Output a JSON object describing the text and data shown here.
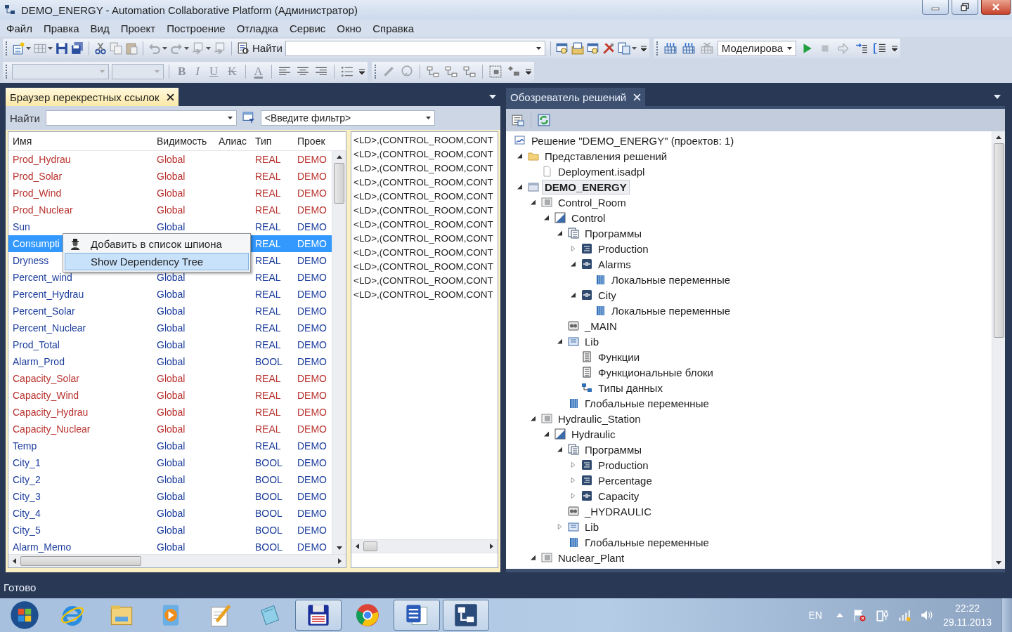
{
  "window": {
    "title": "DEMO_ENERGY - Automation Collaborative Platform (Администратор)"
  },
  "menu": [
    "Файл",
    "Правка",
    "Вид",
    "Проект",
    "Построение",
    "Отладка",
    "Сервис",
    "Окно",
    "Справка"
  ],
  "toolbar": {
    "find_label": "Найти",
    "mode": "Моделирова"
  },
  "format_buttons": [
    {
      "label": "B",
      "kind": "bold",
      "disabled": true
    },
    {
      "label": "I",
      "kind": "italic",
      "disabled": true
    },
    {
      "label": "U",
      "kind": "underline",
      "disabled": true
    },
    {
      "label": "K",
      "kind": "strike",
      "disabled": true
    },
    {
      "label": "A",
      "kind": "color",
      "disabled": true
    }
  ],
  "xref_panel": {
    "tab": {
      "title": "Браузер перекрестных ссылок",
      "selected": true
    },
    "find_label": "Найти",
    "filter": {
      "placeholder": "<Введите фильтр>"
    },
    "columns": [
      "Имя",
      "Видимость",
      "Алиас",
      "Тип",
      "Проек"
    ],
    "rows": [
      {
        "name": "Prod_Hydrau",
        "visibility": "Global",
        "type": "REAL",
        "project": "DEMO",
        "color": "#b8322e",
        "selected": false
      },
      {
        "name": "Prod_Solar",
        "visibility": "Global",
        "type": "REAL",
        "project": "DEMO",
        "color": "#b8322e",
        "selected": false
      },
      {
        "name": "Prod_Wind",
        "visibility": "Global",
        "type": "REAL",
        "project": "DEMO",
        "color": "#b8322e",
        "selected": false
      },
      {
        "name": "Prod_Nuclear",
        "visibility": "Global",
        "type": "REAL",
        "project": "DEMO",
        "color": "#b8322e",
        "selected": false
      },
      {
        "name": "Sun",
        "visibility": "Global",
        "type": "REAL",
        "project": "DEMO",
        "color": "#1c3d9c",
        "selected": false
      },
      {
        "name": "Consumpti",
        "type": "REAL",
        "project": "DEMO",
        "selected": true
      },
      {
        "name": "Dryness",
        "type": "REAL",
        "project": "DEMO",
        "color": "#1c3d9c",
        "selected": false
      },
      {
        "name": "Percent_wind",
        "visibility": "Global",
        "type": "REAL",
        "project": "DEMO",
        "color": "#1c3d9c",
        "selected": false
      },
      {
        "name": "Percent_Hydrau",
        "visibility": "Global",
        "type": "REAL",
        "project": "DEMO",
        "color": "#1c3d9c",
        "selected": false
      },
      {
        "name": "Percent_Solar",
        "visibility": "Global",
        "type": "REAL",
        "project": "DEMO",
        "color": "#1c3d9c",
        "selected": false
      },
      {
        "name": "Percent_Nuclear",
        "visibility": "Global",
        "type": "REAL",
        "project": "DEMO",
        "color": "#1c3d9c",
        "selected": false
      },
      {
        "name": "Prod_Total",
        "visibility": "Global",
        "type": "REAL",
        "project": "DEMO",
        "color": "#1c3d9c",
        "selected": false
      },
      {
        "name": "Alarm_Prod",
        "visibility": "Global",
        "type": "BOOL",
        "project": "DEMO",
        "color": "#1c3d9c",
        "selected": false
      },
      {
        "name": "Capacity_Solar",
        "visibility": "Global",
        "type": "REAL",
        "project": "DEMO",
        "color": "#b8322e",
        "selected": false
      },
      {
        "name": "Capacity_Wind",
        "visibility": "Global",
        "type": "REAL",
        "project": "DEMO",
        "color": "#b8322e",
        "selected": false
      },
      {
        "name": "Capacity_Hydrau",
        "visibility": "Global",
        "type": "REAL",
        "project": "DEMO",
        "color": "#b8322e",
        "selected": false
      },
      {
        "name": "Capacity_Nuclear",
        "visibility": "Global",
        "type": "REAL",
        "project": "DEMO",
        "color": "#b8322e",
        "selected": false
      },
      {
        "name": "Temp",
        "visibility": "Global",
        "type": "REAL",
        "project": "DEMO",
        "color": "#1c3d9c",
        "selected": false
      },
      {
        "name": "City_1",
        "visibility": "Global",
        "type": "BOOL",
        "project": "DEMO",
        "color": "#1c3d9c",
        "selected": false
      },
      {
        "name": "City_2",
        "visibility": "Global",
        "type": "BOOL",
        "project": "DEMO",
        "color": "#1c3d9c",
        "selected": false
      },
      {
        "name": "City_3",
        "visibility": "Global",
        "type": "BOOL",
        "project": "DEMO",
        "color": "#1c3d9c",
        "selected": false
      },
      {
        "name": "City_4",
        "visibility": "Global",
        "type": "BOOL",
        "project": "DEMO",
        "color": "#1c3d9c",
        "selected": false
      },
      {
        "name": "City_5",
        "visibility": "Global",
        "type": "BOOL",
        "project": "DEMO",
        "color": "#1c3d9c",
        "selected": false
      },
      {
        "name": "Alarm_Memo",
        "visibility": "Global",
        "type": "BOOL",
        "project": "DEMO",
        "color": "#1c3d9c",
        "selected": false
      }
    ],
    "references": [
      "<LD>,(CONTROL_ROOM,CONT",
      "<LD>,(CONTROL_ROOM,CONT",
      "<LD>,(CONTROL_ROOM,CONT",
      "<LD>,(CONTROL_ROOM,CONT",
      "<LD>,(CONTROL_ROOM,CONT",
      "<LD>,(CONTROL_ROOM,CONT",
      "<LD>,(CONTROL_ROOM,CONT",
      "<LD>,(CONTROL_ROOM,CONT",
      "<LD>,(CONTROL_ROOM,CONT",
      "<LD>,(CONTROL_ROOM,CONT",
      "<LD>,(CONTROL_ROOM,CONT",
      "<LD>,(CONTROL_ROOM,CONT"
    ]
  },
  "context_menu": {
    "items": [
      {
        "label": "Добавить в список шпиона",
        "kind": "spy",
        "selected": false
      },
      {
        "label": "Show Dependency Tree",
        "selected": true
      }
    ]
  },
  "solution_panel": {
    "tab": {
      "title": "Обозреватель решений",
      "selected": false
    },
    "solution": "Решение \"DEMO_ENERGY\"  (проектов: 1)",
    "tree": [
      {
        "label": "Представления решений",
        "kind": "folder",
        "expanded": true,
        "selected": false,
        "children": [
          {
            "label": "Deployment.isadpl",
            "kind": "file",
            "selected": false
          }
        ]
      },
      {
        "label": "DEMO_ENERGY",
        "kind": "project",
        "expanded": true,
        "selected": true,
        "children": [
          {
            "label": "Control_Room",
            "kind": "station",
            "expanded": true,
            "selected": false,
            "children": [
              {
                "label": "Control",
                "kind": "resource",
                "expanded": true,
                "selected": false,
                "children": [
                  {
                    "label": "Программы",
                    "kind": "programs",
                    "expanded": true,
                    "selected": false,
                    "children": [
                      {
                        "label": "Production",
                        "kind": "program",
                        "expanded": false,
                        "selected": false
                      },
                      {
                        "label": "Alarms",
                        "kind": "fb",
                        "expanded": true,
                        "selected": false,
                        "children": [
                          {
                            "label": "Локальные переменные",
                            "kind": "vars",
                            "selected": false
                          }
                        ]
                      },
                      {
                        "label": "City",
                        "kind": "fb",
                        "expanded": true,
                        "selected": false,
                        "children": [
                          {
                            "label": "Локальные переменные",
                            "kind": "vars",
                            "selected": false
                          }
                        ]
                      }
                    ]
                  },
                  {
                    "label": "_MAIN",
                    "kind": "main",
                    "selected": false
                  },
                  {
                    "label": "Lib",
                    "kind": "lib",
                    "expanded": true,
                    "selected": false,
                    "children": [
                      {
                        "label": "Функции",
                        "kind": "functions",
                        "selected": false
                      },
                      {
                        "label": "Функциональные блоки",
                        "kind": "functions",
                        "selected": false
                      },
                      {
                        "label": "Типы данных",
                        "kind": "types",
                        "selected": false
                      }
                    ]
                  },
                  {
                    "label": "Глобальные переменные",
                    "kind": "vars",
                    "selected": false
                  }
                ]
              }
            ]
          },
          {
            "label": "Hydraulic_Station",
            "kind": "station",
            "expanded": true,
            "selected": false,
            "children": [
              {
                "label": "Hydraulic",
                "kind": "resource",
                "expanded": true,
                "selected": false,
                "children": [
                  {
                    "label": "Программы",
                    "kind": "programs",
                    "expanded": true,
                    "selected": false,
                    "children": [
                      {
                        "label": "Production",
                        "kind": "program",
                        "expanded": false,
                        "selected": false
                      },
                      {
                        "label": "Percentage",
                        "kind": "program",
                        "expanded": false,
                        "selected": false
                      },
                      {
                        "label": "Capacity",
                        "kind": "fb",
                        "expanded": false,
                        "selected": false
                      }
                    ]
                  },
                  {
                    "label": "_HYDRAULIC",
                    "kind": "main",
                    "selected": false
                  },
                  {
                    "label": "Lib",
                    "kind": "lib",
                    "expanded": false,
                    "selected": false
                  },
                  {
                    "label": "Глобальные переменные",
                    "kind": "vars",
                    "selected": false
                  }
                ]
              }
            ]
          },
          {
            "label": "Nuclear_Plant",
            "kind": "station",
            "expanded": true,
            "selected": false
          }
        ]
      }
    ]
  },
  "status_bar": "Готово",
  "taskbar": {
    "apps": [
      {
        "kind": "browser",
        "active": false
      },
      {
        "kind": "folder",
        "active": false
      },
      {
        "kind": "media",
        "active": false
      },
      {
        "kind": "notepen",
        "active": false
      },
      {
        "kind": "notepad",
        "active": false
      },
      {
        "kind": "floppy",
        "active": true
      },
      {
        "kind": "chrome",
        "active": false
      },
      {
        "kind": "word",
        "active": true
      },
      {
        "kind": "app",
        "active": true
      }
    ],
    "language": "EN",
    "time": "22:22",
    "date": "29.11.2013"
  }
}
